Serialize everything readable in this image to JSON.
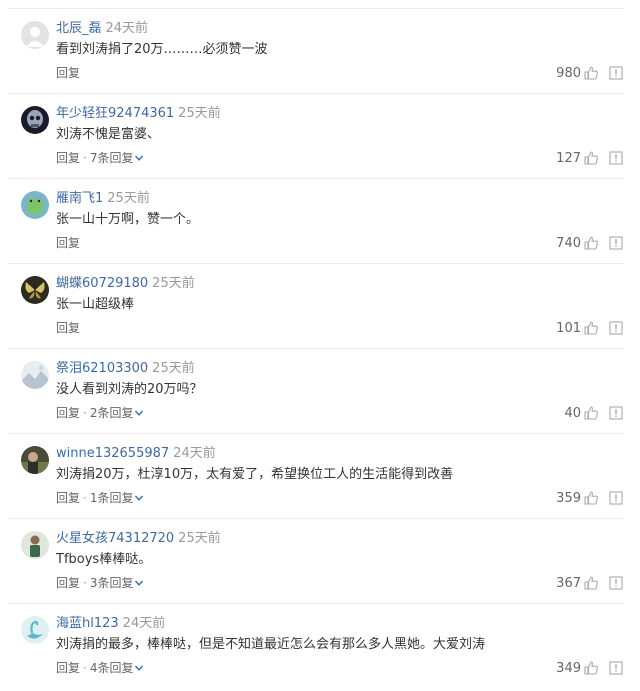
{
  "comments": [
    {
      "user": "北辰_磊",
      "time": "24天前",
      "text": "看到刘涛捐了20万………必须赞一波",
      "reply": "回复",
      "replies": "",
      "likes": "980",
      "avatar": "gray"
    },
    {
      "user": "年少轻狂92474361",
      "time": "25天前",
      "text": "刘涛不愧是富婆、",
      "reply": "回复",
      "replies": "7条回复",
      "likes": "127",
      "avatar": "skull"
    },
    {
      "user": "雁南飞1",
      "time": "25天前",
      "text": "张一山十万啊，赞一个。",
      "reply": "回复",
      "replies": "",
      "likes": "740",
      "avatar": "frog"
    },
    {
      "user": "蝴蝶60729180",
      "time": "25天前",
      "text": "张一山超级棒",
      "reply": "回复",
      "replies": "",
      "likes": "101",
      "avatar": "butterfly"
    },
    {
      "user": "祭泪62103300",
      "time": "25天前",
      "text": "没人看到刘涛的20万吗？",
      "reply": "回复",
      "replies": "2条回复",
      "likes": "40",
      "avatar": "landscape"
    },
    {
      "user": "winne132655987",
      "time": "24天前",
      "text": "刘涛捐20万，杜淳10万，太有爱了，希望换位工人的生活能得到改善",
      "reply": "回复",
      "replies": "1条回复",
      "likes": "359",
      "avatar": "photo"
    },
    {
      "user": "火星女孩74312720",
      "time": "25天前",
      "text": "Tfboys棒棒哒。",
      "reply": "回复",
      "replies": "3条回复",
      "likes": "367",
      "avatar": "person"
    },
    {
      "user": "海蓝hl123",
      "time": "24天前",
      "text": "刘涛捐的最多，棒棒哒，但是不知道最近怎么会有那么多人黑她。大爱刘涛",
      "reply": "回复",
      "replies": "4条回复",
      "likes": "349",
      "avatar": "swan"
    }
  ]
}
